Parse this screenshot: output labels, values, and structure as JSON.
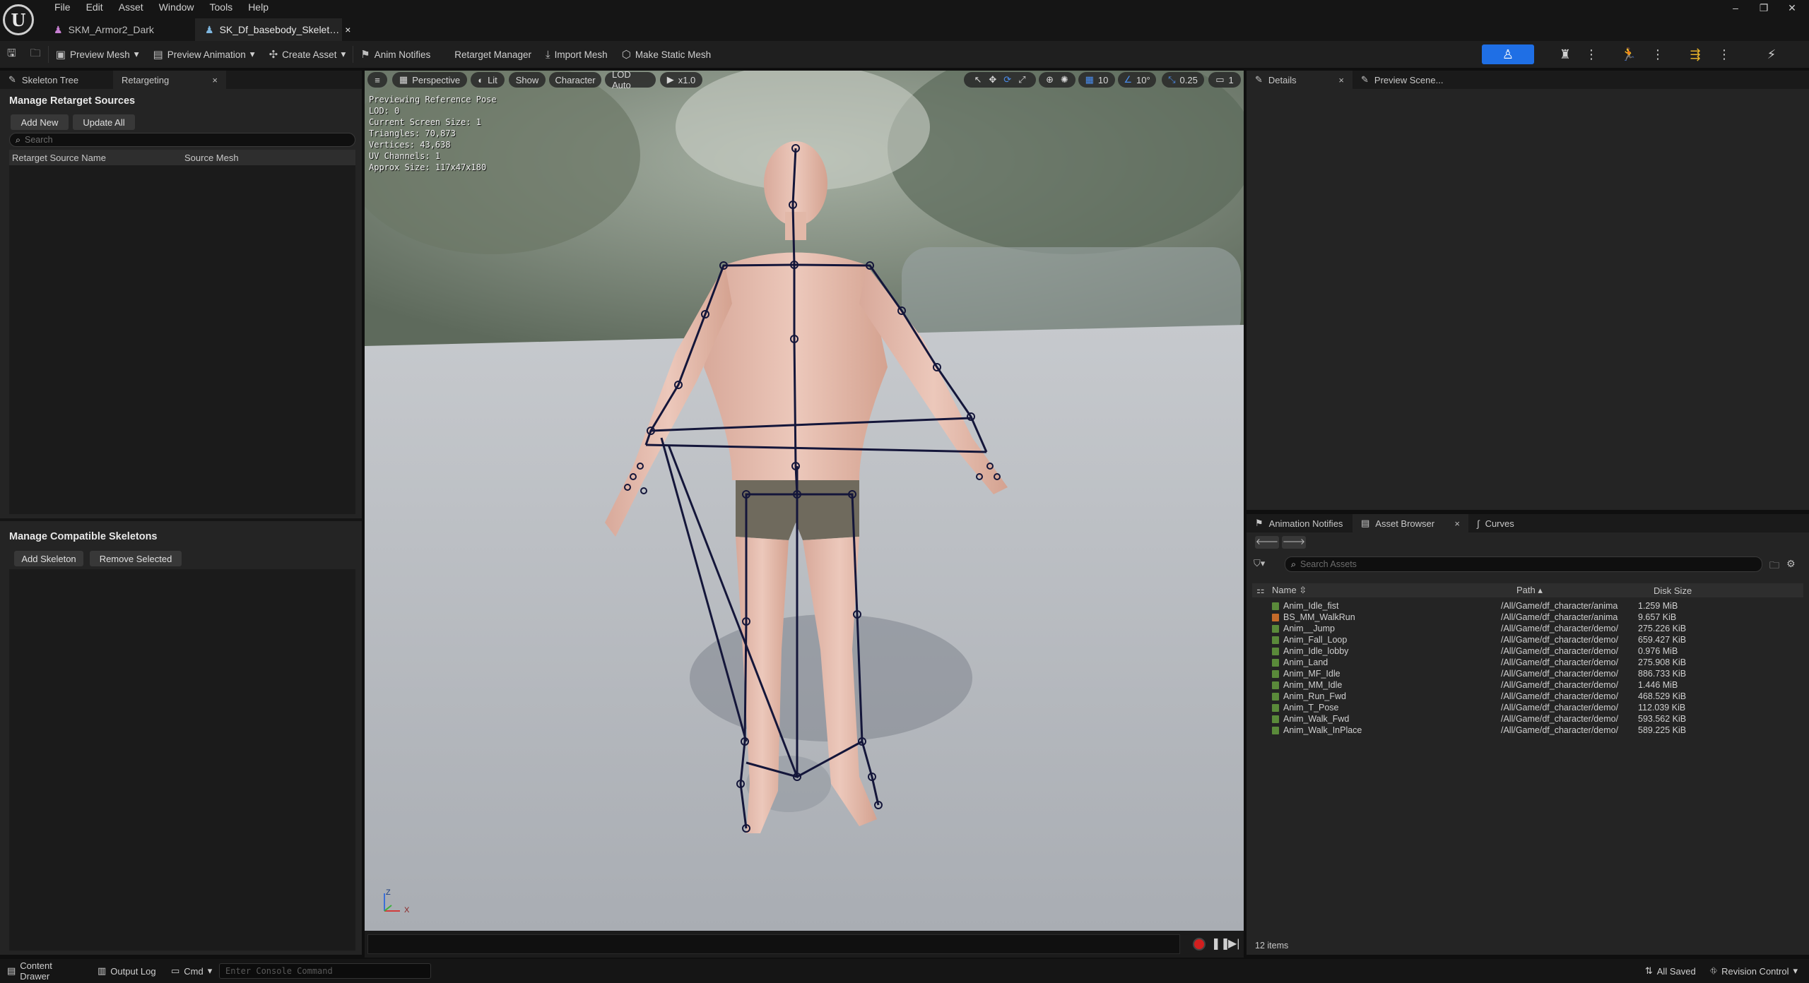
{
  "menu": [
    "File",
    "Edit",
    "Asset",
    "Window",
    "Tools",
    "Help"
  ],
  "doc_tabs": [
    {
      "label": "SKM_Armor2_Dark",
      "icon": "skeletal-mesh-icon"
    },
    {
      "label": "SK_Df_basebody_Skelet…",
      "icon": "skeleton-icon",
      "close": "×"
    }
  ],
  "window_controls": {
    "minimize": "–",
    "restore": "❐",
    "close": "✕"
  },
  "toolbar": {
    "preview_mesh": "Preview Mesh",
    "preview_animation": "Preview Animation",
    "create_asset": "Create Asset",
    "anim_notifies": "Anim Notifies",
    "retarget_manager": "Retarget Manager",
    "import_mesh": "Import Mesh",
    "make_static_mesh": "Make Static Mesh"
  },
  "left_panel": {
    "tabs": [
      {
        "label": "Skeleton Tree"
      },
      {
        "label": "Retargeting",
        "close": "×"
      }
    ],
    "retarget_title": "Manage Retarget Sources",
    "add_new": "Add New",
    "update_all": "Update All",
    "search_placeholder": "Search",
    "col_source_name": "Retarget Source Name",
    "col_source_mesh": "Source Mesh",
    "compatible_title": "Manage Compatible Skeletons",
    "add_skeleton": "Add Skeleton",
    "remove_selected": "Remove Selected"
  },
  "viewport": {
    "perspective": "Perspective",
    "lit": "Lit",
    "show": "Show",
    "character": "Character",
    "lod": "LOD Auto",
    "play_rate": "x1.0",
    "grid_snap": "10",
    "rot_snap": "10°",
    "scale_snap": "0.25",
    "camera_speed": "1",
    "stats": [
      "Previewing Reference Pose",
      "LOD: 0",
      "Current Screen Size: 1",
      "Triangles: 70,873",
      "Vertices: 43,638",
      "UV Channels: 1",
      "Approx Size: 117x47x180"
    ],
    "axis_x": "X",
    "axis_z": "Z"
  },
  "right_panel": {
    "top_tabs": [
      {
        "label": "Details",
        "close": "×"
      },
      {
        "label": "Preview Scene..."
      }
    ],
    "bottom_tabs": [
      {
        "label": "Animation Notifies"
      },
      {
        "label": "Asset Browser",
        "close": "×"
      },
      {
        "label": "Curves"
      }
    ],
    "search_placeholder": "Search Assets",
    "col_name": "Name",
    "col_path": "Path",
    "col_size": "Disk Size",
    "items_count": "12 items",
    "assets": [
      {
        "name": "Anim_Idle_fist",
        "path": "/All/Game/df_character/anima",
        "size": "1.259 MiB",
        "type": "anim"
      },
      {
        "name": "BS_MM_WalkRun",
        "path": "/All/Game/df_character/anima",
        "size": "9.657 KiB",
        "type": "blendspace"
      },
      {
        "name": "Anim__Jump",
        "path": "/All/Game/df_character/demo/",
        "size": "275.226 KiB",
        "type": "anim"
      },
      {
        "name": "Anim_Fall_Loop",
        "path": "/All/Game/df_character/demo/",
        "size": "659.427 KiB",
        "type": "anim"
      },
      {
        "name": "Anim_Idle_lobby",
        "path": "/All/Game/df_character/demo/",
        "size": "0.976 MiB",
        "type": "anim"
      },
      {
        "name": "Anim_Land",
        "path": "/All/Game/df_character/demo/",
        "size": "275.908 KiB",
        "type": "anim"
      },
      {
        "name": "Anim_MF_Idle",
        "path": "/All/Game/df_character/demo/",
        "size": "886.733 KiB",
        "type": "anim"
      },
      {
        "name": "Anim_MM_Idle",
        "path": "/All/Game/df_character/demo/",
        "size": "1.446 MiB",
        "type": "anim"
      },
      {
        "name": "Anim_Run_Fwd",
        "path": "/All/Game/df_character/demo/",
        "size": "468.529 KiB",
        "type": "anim"
      },
      {
        "name": "Anim_T_Pose",
        "path": "/All/Game/df_character/demo/",
        "size": "112.039 KiB",
        "type": "anim"
      },
      {
        "name": "Anim_Walk_Fwd",
        "path": "/All/Game/df_character/demo/",
        "size": "593.562 KiB",
        "type": "anim"
      },
      {
        "name": "Anim_Walk_InPlace",
        "path": "/All/Game/df_character/demo/",
        "size": "589.225 KiB",
        "type": "anim"
      }
    ]
  },
  "statusbar": {
    "content_drawer": "Content Drawer",
    "output_log": "Output Log",
    "cmd": "Cmd",
    "console_placeholder": "Enter Console Command",
    "all_saved": "All Saved",
    "revision_control": "Revision Control"
  },
  "colors": {
    "accent_blue": "#1f6fe5",
    "bone": "#14163a",
    "record": "#d21f1f"
  }
}
